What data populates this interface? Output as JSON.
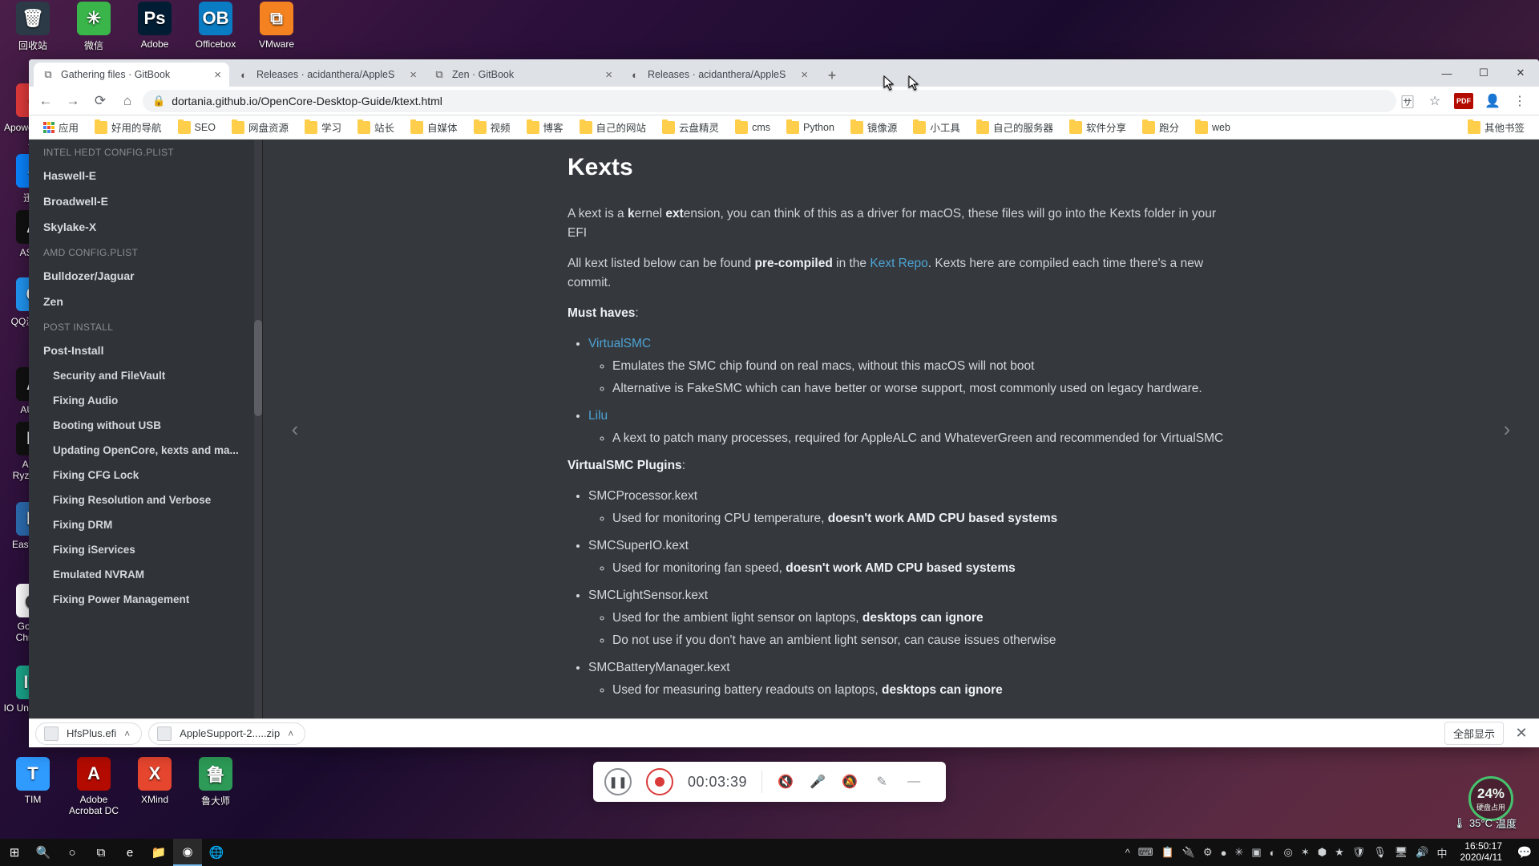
{
  "desktop_icons": [
    {
      "label": "回收站",
      "bg": "#2b3a46",
      "glyph": "🗑"
    },
    {
      "label": "微信",
      "bg": "#39b54a",
      "glyph": "✳"
    },
    {
      "label": "Adobe",
      "bg": "#001d34",
      "glyph": "Ps"
    },
    {
      "label": "Officebox",
      "bg": "#0a7cc3",
      "glyph": "OB"
    },
    {
      "label": "VMware",
      "bg": "#f58220",
      "glyph": "⧉"
    },
    {
      "label": "Apowersoft录屏",
      "bg": "#e23b3b",
      "glyph": "●"
    },
    {
      "label": "迅雷",
      "bg": "#0a84ff",
      "glyph": "⇩"
    },
    {
      "label": "ASUS",
      "bg": "#111",
      "glyph": "A"
    },
    {
      "label": "QQ浏览器",
      "bg": "#2196f3",
      "glyph": "Q"
    },
    {
      "label": "AULA",
      "bg": "#111",
      "glyph": "A"
    },
    {
      "label": "AMD RyzenMa",
      "bg": "#111",
      "glyph": "R"
    },
    {
      "label": "EasyBCD",
      "bg": "#2b6cb0",
      "glyph": "B"
    },
    {
      "label": "Google Chrome",
      "bg": "#fff",
      "glyph": "◉"
    },
    {
      "label": "IO Uninstaller",
      "bg": "#1aa58a",
      "glyph": "IO"
    },
    {
      "label": "TIM",
      "bg": "#2f9bff",
      "glyph": "T"
    },
    {
      "label": "Adobe Acrobat DC",
      "bg": "#b30b00",
      "glyph": "A"
    },
    {
      "label": "XMind",
      "bg": "#e6452e",
      "glyph": "X"
    },
    {
      "label": "鲁大师",
      "bg": "#2d9b57",
      "glyph": "鲁"
    }
  ],
  "tabs": [
    {
      "title": "Gathering files · GitBook",
      "fav": "⧉",
      "active": true
    },
    {
      "title": "Releases · acidanthera/AppleS",
      "fav": "◐",
      "active": false
    },
    {
      "title": "Zen · GitBook",
      "fav": "⧉",
      "active": false
    },
    {
      "title": "Releases · acidanthera/AppleS",
      "fav": "◐",
      "active": false
    }
  ],
  "window_controls": {
    "min": "—",
    "max": "☐",
    "close": "✕"
  },
  "toolbar": {
    "back": "←",
    "forward": "→",
    "reload": "⟳",
    "home": "⌂",
    "translate": "🈂",
    "star": "☆",
    "pdf": "PDF",
    "avatar": "👤",
    "menu": "⋮"
  },
  "omnibox": {
    "lock": "🔒",
    "url": "dortania.github.io/OpenCore-Desktop-Guide/ktext.html"
  },
  "bookmarks": [
    {
      "label": "应用",
      "first": true
    },
    {
      "label": "好用的导航"
    },
    {
      "label": "SEO"
    },
    {
      "label": "网盘资源"
    },
    {
      "label": "学习"
    },
    {
      "label": "站长"
    },
    {
      "label": "自媒体"
    },
    {
      "label": "视频"
    },
    {
      "label": "博客"
    },
    {
      "label": "自己的网站"
    },
    {
      "label": "云盘精灵"
    },
    {
      "label": "cms"
    },
    {
      "label": "Python"
    },
    {
      "label": "镜像源"
    },
    {
      "label": "小工具"
    },
    {
      "label": "自己的服务器"
    },
    {
      "label": "软件分享"
    },
    {
      "label": "跑分"
    },
    {
      "label": "web"
    }
  ],
  "bm_overflow": "其他书签",
  "sidebar": {
    "sections": [
      {
        "head": "INTEL HEDT CONFIG.PLIST",
        "items": [
          "Haswell-E",
          "Broadwell-E",
          "Skylake-X"
        ]
      },
      {
        "head": "AMD CONFIG.PLIST",
        "items": [
          "Bulldozer/Jaguar",
          "Zen"
        ]
      },
      {
        "head": "POST INSTALL",
        "items": [
          "Post-Install"
        ],
        "subitems": [
          "Security and FileVault",
          "Fixing Audio",
          "Booting without USB",
          "Updating OpenCore, kexts and ma...",
          "Fixing CFG Lock",
          "Fixing Resolution and Verbose",
          "Fixing DRM",
          "Fixing iServices",
          "Emulated NVRAM",
          "Fixing Power Management"
        ]
      }
    ]
  },
  "doc": {
    "title": "Kexts",
    "p1a": "A kext is a ",
    "p1b": "k",
    "p1c": "ernel ",
    "p1d": "ext",
    "p1e": "ension, you can think of this as a driver for macOS, these files will go into the Kexts folder in your EFI",
    "p2a": "All kext listed below can be found ",
    "p2b": "pre-compiled",
    "p2c": " in the ",
    "p2link": "Kext Repo",
    "p2d": ". Kexts here are compiled each time there's a new commit.",
    "musthaves": "Must haves",
    "colon": ":",
    "vsmc": "VirtualSMC",
    "vsmc_d1": "Emulates the SMC chip found on real macs, without this macOS will not boot",
    "vsmc_d2": "Alternative is FakeSMC which can have better or worse support, most commonly used on legacy hardware.",
    "lilu": "Lilu",
    "lilu_d1": "A kext to patch many processes, required for AppleALC and WhateverGreen and recommended for VirtualSMC",
    "vplug": "VirtualSMC Plugins",
    "smcproc": "SMCProcessor.kext",
    "smcproc_d_a": "Used for monitoring CPU temperature, ",
    "smcproc_d_b": "doesn't work AMD CPU based systems",
    "smcsio": "SMCSuperIO.kext",
    "smcsio_d_a": "Used for monitoring fan speed, ",
    "smcsio_d_b": "doesn't work AMD CPU based systems",
    "smclight": "SMCLightSensor.kext",
    "smclight_d_a": "Used for the ambient light sensor on laptops, ",
    "smclight_d_b": "desktops can ignore",
    "smclight_d2": "Do not use if you don't have an ambient light sensor, can cause issues otherwise",
    "smcbatt": "SMCBatteryManager.kext",
    "smcbatt_d_a": "Used for measuring battery readouts on laptops, ",
    "smcbatt_d_b": "desktops can ignore"
  },
  "nav": {
    "prev": "‹",
    "next": "›"
  },
  "downloads": [
    {
      "name": "HfsPlus.efi"
    },
    {
      "name": "AppleSupport-2.....zip"
    }
  ],
  "dl_all": "全部显示",
  "dl_close": "✕",
  "recorder": {
    "pause": "❚❚",
    "time": "00:03:39",
    "mute": "🔇",
    "mic": "🎤",
    "bell": "🔕",
    "pen": "✎",
    "min": "—"
  },
  "disk": {
    "pct": "24%",
    "label": "硬盘占用"
  },
  "temp": {
    "value": "35°C",
    "label": "温度"
  },
  "taskbar": {
    "left": [
      "⊞",
      "🔍",
      "○",
      "⧉",
      "e",
      "📁",
      "◉",
      "🌐"
    ],
    "tray": [
      "^",
      "⌨",
      "📋",
      "🔌",
      "⚙",
      "●",
      "✳",
      "▣",
      "◐",
      "◎",
      "✶",
      "⬢",
      "★",
      "🛡",
      "🎙",
      "🖥",
      "🔊",
      "中"
    ],
    "time": "16:50:17",
    "date": "2020/4/11",
    "notif": "💬"
  }
}
